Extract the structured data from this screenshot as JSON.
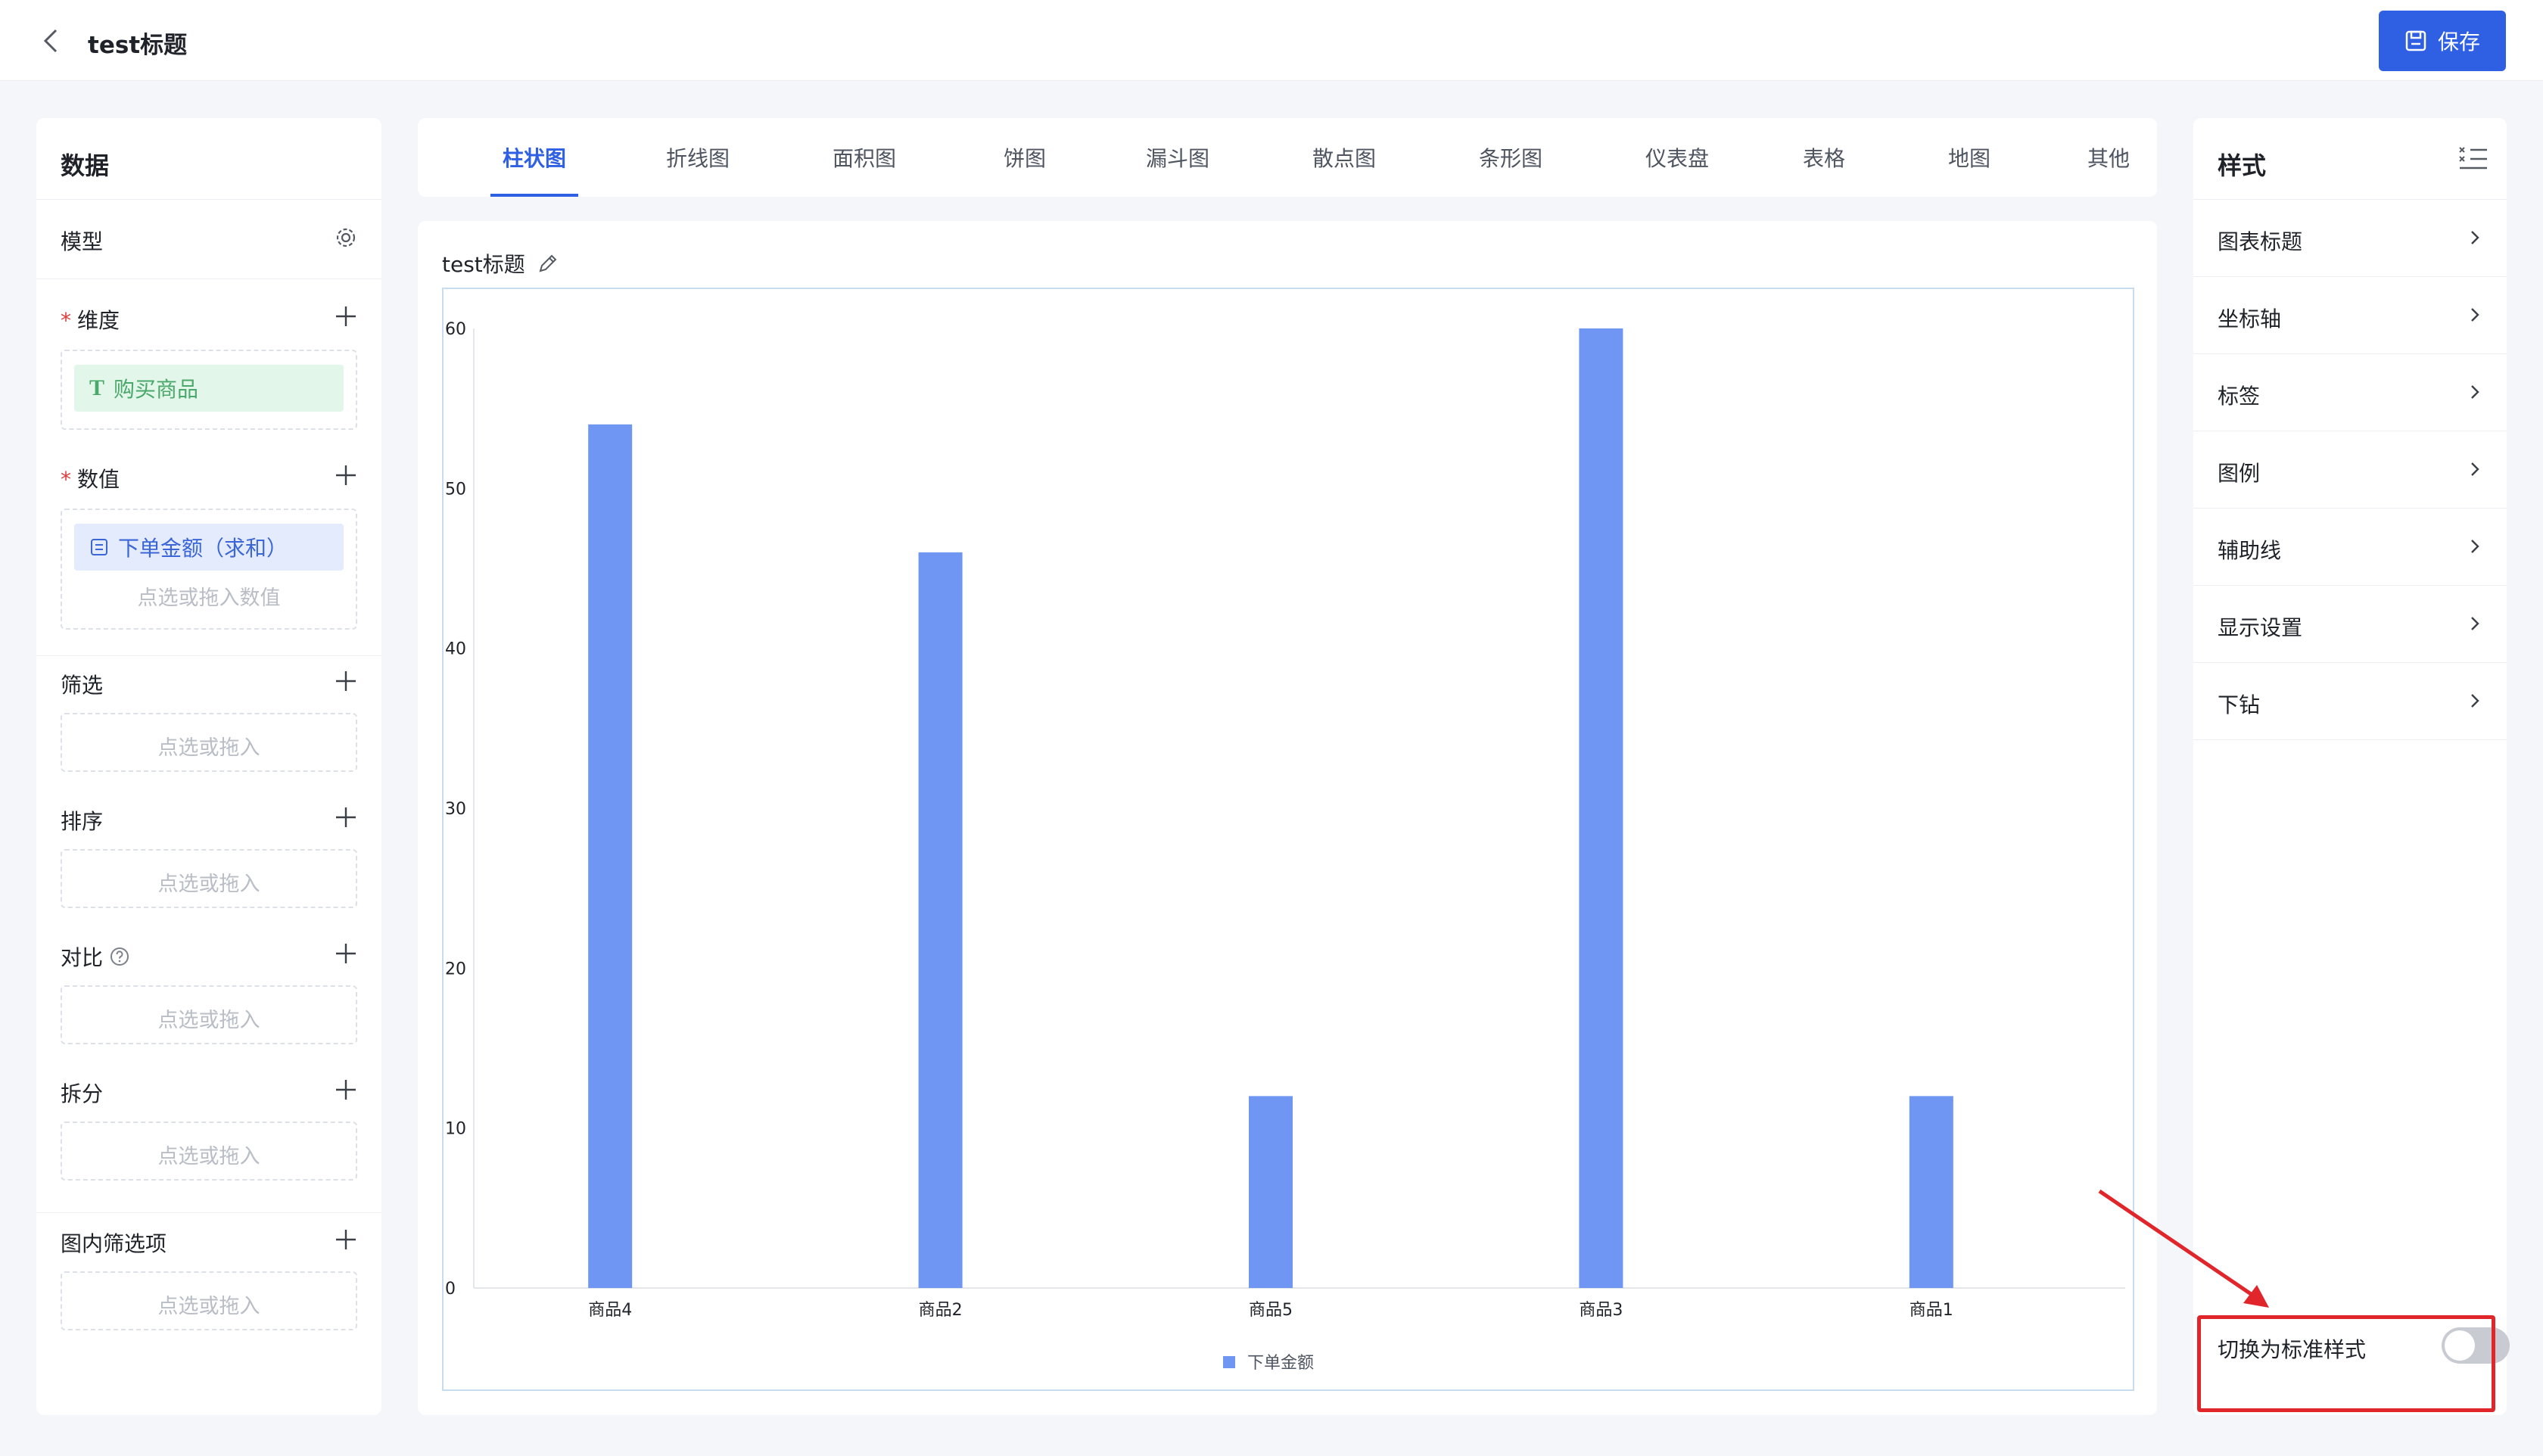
{
  "header": {
    "title": "test标题",
    "save_label": "保存"
  },
  "data_panel": {
    "title": "数据",
    "model_label": "模型",
    "dimension_label": "维度",
    "dimension_field": "购买商品",
    "value_label": "数值",
    "value_field": "下单金额（求和）",
    "value_placeholder": "点选或拖入数值",
    "filter_label": "筛选",
    "sort_label": "排序",
    "compare_label": "对比",
    "split_label": "拆分",
    "inner_filter_label": "图内筛选项",
    "drop_placeholder": "点选或拖入"
  },
  "tabs": [
    "柱状图",
    "折线图",
    "面积图",
    "饼图",
    "漏斗图",
    "散点图",
    "条形图",
    "仪表盘",
    "表格",
    "地图",
    "其他"
  ],
  "chart_title": "test标题",
  "chart_data": {
    "type": "bar",
    "categories": [
      "商品4",
      "商品2",
      "商品5",
      "商品3",
      "商品1"
    ],
    "series": [
      {
        "name": "下单金额",
        "values": [
          54,
          46,
          12,
          60,
          12
        ]
      }
    ],
    "ylim": [
      0,
      60
    ],
    "yticks": [
      0,
      10,
      20,
      30,
      40,
      50,
      60
    ],
    "legend": "bottom-center",
    "bar_color": "#6f96f2",
    "grid": false
  },
  "style_panel": {
    "title": "样式",
    "items": [
      "图表标题",
      "坐标轴",
      "标签",
      "图例",
      "辅助线",
      "显示设置",
      "下钻"
    ],
    "switch_label": "切换为标准样式",
    "switch_on": false
  },
  "colors": {
    "primary": "#2f5fe3",
    "bar": "#6f96f2",
    "highlight": "#e0262b"
  }
}
